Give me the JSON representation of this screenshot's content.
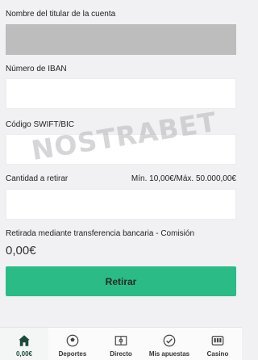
{
  "form": {
    "holder_label": "Nombre del titular de la cuenta",
    "holder_value": "",
    "iban_label": "Número de IBAN",
    "iban_value": "",
    "swift_label": "Código SWIFT/BIC",
    "swift_value": "",
    "amount_label": "Cantidad a retirar",
    "amount_limits": "Mín. 10,00€/Máx. 50.000,00€",
    "amount_value": "",
    "fee_label": "Retirada mediante transferencia bancaria - Comisión",
    "fee_value": "0,00€",
    "submit_label": "Retirar"
  },
  "watermark": "NOSTRABET",
  "bottom_nav": {
    "items": [
      {
        "label": "0,00€",
        "icon": "home-icon",
        "active": true
      },
      {
        "label": "Deportes",
        "icon": "soccer-ball-icon",
        "active": false
      },
      {
        "label": "Directo",
        "icon": "field-icon",
        "active": false
      },
      {
        "label": "Mis apuestas",
        "icon": "check-circle-icon",
        "active": false
      },
      {
        "label": "Casino",
        "icon": "slot-machine-icon",
        "active": false
      }
    ]
  },
  "colors": {
    "accent": "#2bbb86",
    "active_nav": "#1a4b3a",
    "disabled_field": "#bdbdbd"
  }
}
